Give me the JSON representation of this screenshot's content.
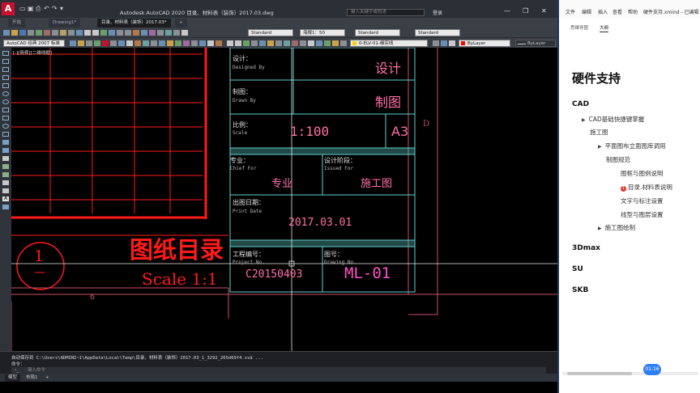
{
  "app": {
    "title": "Autodesk AutoCAD 2020   目录、材料表（装饰）2017.03.dwg",
    "quick_access": [
      "▭",
      "▣",
      "⎙",
      "↶",
      "↷",
      "▾"
    ],
    "search_placeholder": "键入关键字或短语",
    "login": "登录",
    "window_buttons": [
      "—",
      "❐",
      "✕"
    ]
  },
  "tabs": [
    {
      "label": "开始"
    },
    {
      "label": "Drawing1*"
    },
    {
      "label": "目录、材料表（装饰）2017.03*"
    },
    {
      "label": "+"
    }
  ],
  "toolbar": {
    "text_style": "Standard",
    "dim_style": "海报1：50",
    "table_style": "Standard",
    "ml_style": "Standard",
    "workspace": "AutoCAD 经典 2007 标准",
    "layer": "0-ELV-01-细实线",
    "color": "ByLayer",
    "linetype": "ByLayer",
    "colors": {
      "accent": "#c8102e",
      "layer_yellow": "#f5d800",
      "bylayer_red": "#ff0000"
    }
  },
  "canvas": {
    "viewport_label": "[-][俯视][二维线框]",
    "colors": {
      "red": "#ff1a1a",
      "cyan": "#5fd0cf",
      "pink": "#ff6fa8",
      "magenta": "#ff4fc8",
      "teal": "#5fe0c8"
    },
    "title_block": {
      "designed_label_cn": "设计：",
      "designed_label_en": "Designed By",
      "designed_value": "设计",
      "drawn_label_cn": "制图：",
      "drawn_label_en": "Drawn By",
      "drawn_value": "制图",
      "scale_label_cn": "比例：",
      "scale_label_en": "Scale",
      "scale_value": "1:100",
      "size_value": "A3",
      "specialty_label_cn": "专业：",
      "specialty_label_en": "Chief For",
      "specialty_value": "专业",
      "phase_label_cn": "设计阶段：",
      "phase_label_en": "Issued For",
      "phase_value": "施工图",
      "date_label_cn": "出图日期：",
      "date_label_en": "Print Date",
      "date_value": "2017.03.01",
      "project_label_cn": "工程编号：",
      "project_label_en": "Project No.",
      "project_value": "C20150403",
      "drawing_label_cn": "图号：",
      "drawing_label_en": "Drawing No.",
      "drawing_value": "ML-01"
    },
    "big_title": "图纸目录",
    "big_scale": "Scale 1:1",
    "circle_number": "1",
    "circle_dash": "—",
    "grid_mark_6": "6",
    "grid_mark_d": "D"
  },
  "command": {
    "line1": "自动保存到 C:\\Users\\ADMINI~1\\AppData\\Local\\Temp\\目录、材料表（装饰）2017.03_1_3292_265d69f4.sv$ ...",
    "line2": "命令：",
    "input_placeholder": "键入命令"
  },
  "layouts": [
    "模型",
    "布局1",
    "+"
  ],
  "panel": {
    "menu": [
      "文件",
      "编辑",
      "插入",
      "查看",
      "帮助",
      "硬件支持.xmind - 已编辑"
    ],
    "tabs": [
      "思维导图",
      "大纲"
    ],
    "outline": {
      "title": "硬件支持",
      "cad": "CAD",
      "cad_basic": "CAD基础快捷键掌握",
      "construction": "施工图",
      "plan_elev": "平面图布立面图库调用",
      "standards": "制图规范",
      "frame_legend": "图框与图例说明",
      "catalog": "目录.材料表说明",
      "text_dim": "文字与标注设置",
      "line_layer": "线型与图层设置",
      "construction_draw": "施工图绘制",
      "max3d": "3Dmax",
      "su": "SU",
      "skb": "SKB"
    },
    "time": "01:16"
  }
}
